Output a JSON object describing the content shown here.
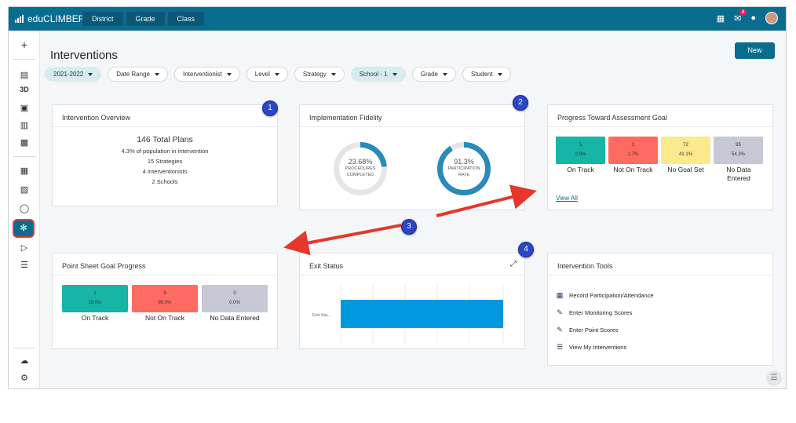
{
  "app": {
    "name": "eduCLIMBER"
  },
  "topnav": [
    "District",
    "Grade",
    "Class"
  ],
  "topbar": {
    "notification_count": "8"
  },
  "page": {
    "title": "Interventions",
    "new_button": "New"
  },
  "filters": [
    {
      "label": "2021-2022",
      "selected": true
    },
    {
      "label": "Date Range",
      "selected": false
    },
    {
      "label": "Interventionist",
      "selected": false
    },
    {
      "label": "Level",
      "selected": false
    },
    {
      "label": "Strategy",
      "selected": false
    },
    {
      "label": "School - 1",
      "selected": true
    },
    {
      "label": "Grade",
      "selected": false
    },
    {
      "label": "Student",
      "selected": false
    }
  ],
  "sidebar": {
    "items": [
      "plus-icon",
      "id-card-icon",
      "3D",
      "presentation-icon",
      "chart-icon",
      "bus-icon",
      "calendar-icon",
      "clipboard-icon",
      "tag-icon",
      "intervention-icon",
      "flag-icon",
      "list-icon",
      "cloud-icon",
      "gear-icon"
    ],
    "label_3d": "3D"
  },
  "overview": {
    "title": "Intervention Overview",
    "total": "146 Total Plans",
    "lines": [
      "4.3% of population in intervention",
      "15 Strategies",
      "4 Interventionists",
      "2 Schools"
    ]
  },
  "fidelity": {
    "title": "Implementation Fidelity",
    "donuts": [
      {
        "value": "23.68%",
        "label1": "PROCEDURES",
        "label2": "COMPLETED",
        "fraction": 0.2368
      },
      {
        "value": "91.3%",
        "label1": "PARTICIPATION",
        "label2": "RATE",
        "fraction": 0.913
      }
    ]
  },
  "progress_goal": {
    "title": "Progress Toward Assessment Goal",
    "tiles": [
      {
        "count": "5",
        "pct": "2.9%",
        "label": "On Track",
        "color": "#17b5a5"
      },
      {
        "count": "3",
        "pct": "1.7%",
        "label": "Not On Track",
        "color": "#ff6b61"
      },
      {
        "count": "72",
        "pct": "41.1%",
        "label": "No Goal Set",
        "color": "#fbe98e"
      },
      {
        "count": "95",
        "pct": "54.3%",
        "label": "No Data Entered",
        "color": "#c6c8d4"
      }
    ],
    "view_all": "View All"
  },
  "point_sheet": {
    "title": "Point Sheet Goal Progress",
    "tiles": [
      {
        "count": "1",
        "pct": "10.0%",
        "label": "On Track",
        "color": "#17b5a5"
      },
      {
        "count": "9",
        "pct": "90.0%",
        "label": "Not On Track",
        "color": "#ff6b61"
      },
      {
        "count": "0",
        "pct": "0.0%",
        "label": "No Data Entered",
        "color": "#c6c8d4"
      }
    ]
  },
  "exit_status": {
    "title": "Exit Status",
    "bar_label": "Exit Sta..."
  },
  "tools": {
    "title": "Intervention Tools",
    "items": [
      {
        "icon": "calendar-icon",
        "label": "Record Participation/Attendance"
      },
      {
        "icon": "edit-icon",
        "label": "Enter Monitoring Scores"
      },
      {
        "icon": "edit-icon",
        "label": "Enter Point Scores"
      },
      {
        "icon": "list-icon",
        "label": "View My Interventions"
      }
    ]
  },
  "callouts": [
    "1",
    "2",
    "3",
    "4"
  ],
  "colors": {
    "brand": "#0a6c8f",
    "accent_blue": "#0099e0",
    "donut_track": "#e6e6e6",
    "donut_fill": "#2a8ab8",
    "arrow": "#e5372b"
  }
}
